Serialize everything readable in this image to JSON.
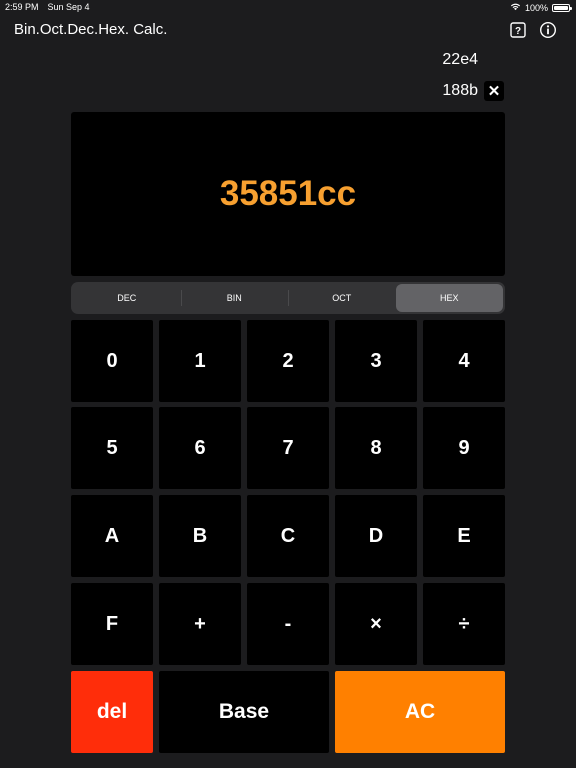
{
  "status_bar": {
    "time": "2:59 PM",
    "date": "Sun Sep 4",
    "battery": "100%"
  },
  "app": {
    "title": "Bin.Oct.Dec.Hex. Calc."
  },
  "history": [
    "22e4",
    "188b"
  ],
  "display": {
    "value": "35851cc",
    "color": "#f7a030"
  },
  "modes": {
    "options": [
      "DEC",
      "BIN",
      "OCT",
      "HEX"
    ],
    "selected": "HEX"
  },
  "keypad": {
    "rows": [
      [
        "0",
        "1",
        "2",
        "3",
        "4"
      ],
      [
        "5",
        "6",
        "7",
        "8",
        "9"
      ],
      [
        "A",
        "B",
        "C",
        "D",
        "E"
      ],
      [
        "F",
        "+",
        "-",
        "×",
        "÷"
      ]
    ],
    "del_label": "del",
    "base_label": "Base",
    "ac_label": "AC"
  },
  "colors": {
    "background": "#1c1c1e",
    "key": "#000000",
    "del": "#ff2d0a",
    "ac": "#ff8000"
  }
}
